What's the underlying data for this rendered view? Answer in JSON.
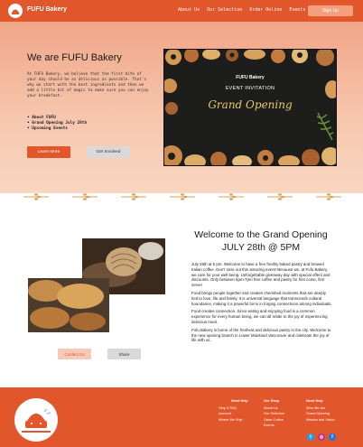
{
  "nav": {
    "brand": "FUFU Bakery",
    "links": [
      "About Us",
      "Our Selection",
      "Order Online",
      "Events"
    ],
    "signup": "Sign Up"
  },
  "hero": {
    "title": "We are FUFU Bakery",
    "intro": "At FUFU Bakery, we believe that the first bite of your day should be as delicious as possible. That's why we start with the best ingredients and then we add a little bit of magic to make sure you can enjoy your breakfast.",
    "bullets": [
      "About FUFU",
      "Grand Opening July 28th",
      "Upcoming Events"
    ],
    "learn_more": "Learn More",
    "get_involved": "Get Involved",
    "invite": {
      "brand": "FUFU Bakery",
      "subtitle": "EVENT INVITATION",
      "headline": "Grand Opening"
    }
  },
  "section": {
    "title_line1": "Welcome to the Grand Opening",
    "title_line2": "JULY 28th @ 5PM",
    "paragraphs": [
      "July 28th at 5 pm. Welcome to have a free freshly baked pastry and brewed Italian coffee. Don't miss out this amazing event! Because we, at Fufu Bakery, we care for your well being. Unforgettable giveaway day with special offers and discounts. Only between 5pm-7pm free coffee and pastry for first come, first serve!",
      "Food brings people together and creates cherished moments that are deeply tied to love, life and family. It is universal language that transcends cultural boundaries, making it a powerful force in forging connections among individuals.",
      "Food creates connection. Since eating and enjoying food is a common experience for every human being, we can all relate to the joy of experiencing delicious meal.",
      "Fufu Bakery is home of the freshest and delicious pastry in the city. Welcome to the new opening branch in Lower Mainland Vancouver and celebrate the joy of life with us."
    ],
    "contact": "Contact Us",
    "share": "Share"
  },
  "footer": {
    "col1": {
      "heading": "Need Help",
      "items": [
        "Help & FAQ",
        "Account",
        "Where We Ship"
      ]
    },
    "col2": {
      "heading": "Our Shop",
      "items": [
        "About Us",
        "Our Selection",
        "Order Online",
        "Events"
      ]
    },
    "col3": {
      "heading": "Need Help",
      "items": [
        "Who We Are",
        "Grand Opening",
        "Mission and Vision"
      ]
    },
    "social": [
      "twitter-icon",
      "instagram-icon",
      "facebook-icon"
    ]
  },
  "colors": {
    "brand": "#e2562b",
    "brand_light": "#f4a07f",
    "gold": "#e8c86a"
  }
}
